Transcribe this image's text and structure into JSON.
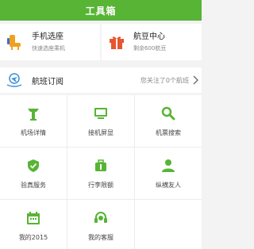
{
  "header": {
    "title": "工具箱"
  },
  "cards": [
    {
      "title": "手机选座",
      "subtitle": "快速选座乘机",
      "icon": "seat-icon",
      "color": "#f0a020"
    },
    {
      "title": "航豆中心",
      "subtitle": "剩余600航豆",
      "icon": "gift-icon",
      "color": "#e8552e"
    }
  ],
  "flight_subscription": {
    "label": "航班订阅",
    "note": "您关注了0个航班",
    "icon": "flight-subscribe-icon"
  },
  "grid": {
    "accent_color": "#57b435",
    "items": [
      {
        "label": "机场详情",
        "icon": "airport-tower-icon"
      },
      {
        "label": "接机屏显",
        "icon": "monitor-icon"
      },
      {
        "label": "机票搜索",
        "icon": "search-icon"
      },
      {
        "label": "验真服务",
        "icon": "shield-check-icon"
      },
      {
        "label": "行李限额",
        "icon": "luggage-icon"
      },
      {
        "label": "纵横友人",
        "icon": "user-icon"
      },
      {
        "label": "我的2015",
        "icon": "calendar-icon"
      },
      {
        "label": "我的客服",
        "icon": "headset-icon"
      },
      {
        "label": "",
        "icon": ""
      }
    ]
  }
}
